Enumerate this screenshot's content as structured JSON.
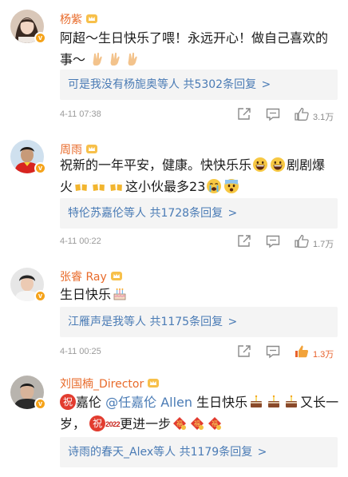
{
  "comments": [
    {
      "username": "杨紫",
      "text_a": "阿超～生日快乐了喂！永远开心！做自己喜欢的",
      "text_b": "事～",
      "emoji": [
        "victory-hand",
        "victory-hand",
        "victory-hand"
      ],
      "reply_preview": "可是我没有杨旎奥等人",
      "reply_count": "共5302条回复",
      "reply_arrow": ">",
      "time": "4-11 07:38",
      "likes": "3.1万",
      "liked": false
    },
    {
      "username": "周雨",
      "text_a": "祝新的一年平安，健康。快快乐乐",
      "text_b": "剧剧爆",
      "text_c": "火",
      "text_d": "这小伙最多23",
      "emoji": [
        "grinning-face",
        "grinning-face",
        "beer-mugs",
        "beer-mugs",
        "beer-mugs",
        "loudly-crying-face",
        "fearful-face"
      ],
      "reply_preview": "特伦苏嘉伦等人",
      "reply_count": "共1728条回复",
      "reply_arrow": ">",
      "time": "4-11 00:22",
      "likes": "1.7万",
      "liked": false
    },
    {
      "username": "张睿 Ray",
      "text_a": "生日快乐",
      "emoji": [
        "birthday-cake"
      ],
      "reply_preview": "江雁声是我等人",
      "reply_count": "共1175条回复",
      "reply_arrow": ">",
      "time": "4-11 00:25",
      "likes": "1.3万",
      "liked": true
    },
    {
      "username": "刘国楠_Director",
      "zhu_badge": "祝",
      "name_before": "嘉伦",
      "mention": "@任嘉伦 Allen",
      "text_a": "生日快乐",
      "text_b": "又长一",
      "text_c": "岁，",
      "badge_year": "2022",
      "text_d": "更进一步",
      "fu_char": "福",
      "emoji": [
        "birthday-cake",
        "birthday-cake",
        "birthday-cake",
        "fu-blessing",
        "fu-blessing",
        "fu-blessing"
      ],
      "reply_preview": "诗雨的春天_Alex等人",
      "reply_count": "共1179条回复",
      "reply_arrow": ">"
    }
  ],
  "colors": {
    "username": "#e86b2b",
    "link": "#4a7bb5",
    "liked": "#e8622c",
    "verified_badge": "#f5a31a"
  }
}
